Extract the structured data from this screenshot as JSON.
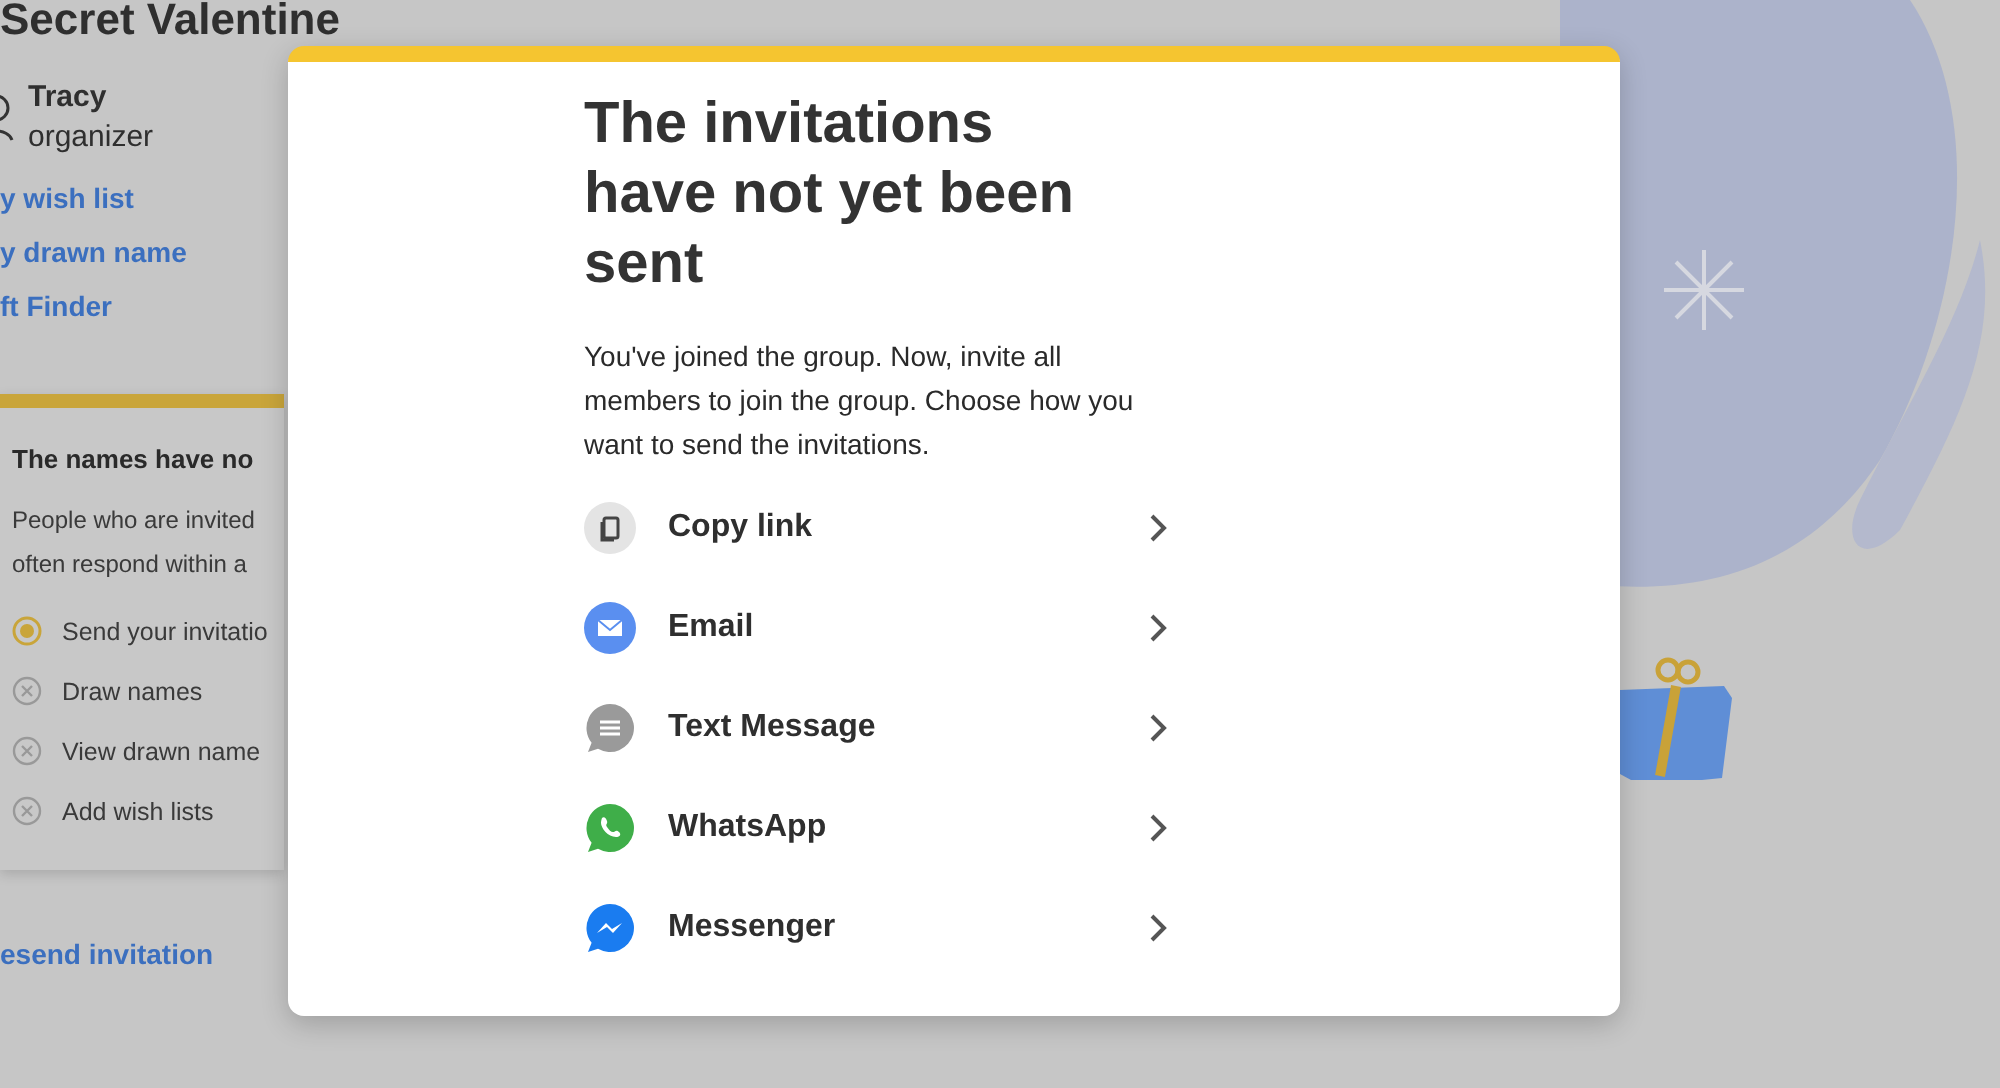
{
  "page": {
    "title": "Secret Valentine",
    "user": {
      "name": "Tracy",
      "role": "organizer"
    },
    "links": [
      "y wish list",
      "y drawn name",
      "ft Finder"
    ],
    "status_card": {
      "title": "The names have no",
      "text": [
        "People who are invited",
        "often respond within a"
      ],
      "steps": [
        {
          "label": "Send your invitatio",
          "active": true
        },
        {
          "label": "Draw names",
          "active": false
        },
        {
          "label": "View drawn name",
          "active": false
        },
        {
          "label": "Add wish lists",
          "active": false
        }
      ]
    },
    "footer_link": "esend invitation"
  },
  "modal": {
    "title": "The invitations have not yet been sent",
    "text": "You've joined the group. Now, invite all members to join the group. Choose how you want to send the invitations.",
    "options": [
      {
        "kind": "copy",
        "label": "Copy link"
      },
      {
        "kind": "email",
        "label": "Email"
      },
      {
        "kind": "sms",
        "label": "Text Message"
      },
      {
        "kind": "whatsapp",
        "label": "WhatsApp"
      },
      {
        "kind": "messenger",
        "label": "Messenger"
      }
    ]
  }
}
